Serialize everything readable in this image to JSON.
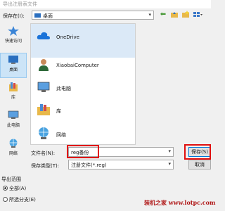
{
  "window": {
    "title": "导出注册表文件"
  },
  "toolbar": {
    "save_in_label": "保存在(I):",
    "save_in_value": "桌面",
    "back_icon": "back-arrow-icon",
    "up_icon": "up-folder-icon",
    "new_folder_icon": "new-folder-icon",
    "view_menu_icon": "view-menu-icon"
  },
  "places": [
    {
      "label": "快速访问",
      "icon": "star-icon"
    },
    {
      "label": "桌面",
      "icon": "desktop-icon",
      "selected": true
    },
    {
      "label": "库",
      "icon": "library-icon"
    },
    {
      "label": "此电脑",
      "icon": "computer-icon"
    },
    {
      "label": "网络",
      "icon": "network-icon"
    }
  ],
  "files": [
    {
      "name": "OneDrive",
      "icon": "cloud-icon"
    },
    {
      "name": "XiaobaiComputer",
      "icon": "user-icon"
    },
    {
      "name": "此电脑",
      "icon": "computer-icon"
    },
    {
      "name": "库",
      "icon": "library-icon"
    },
    {
      "name": "网络",
      "icon": "network-icon"
    }
  ],
  "form": {
    "filename_label": "文件名(N):",
    "filename_value": "reg备份",
    "type_label": "保存类型(T):",
    "type_value": "注册文件(*.reg)",
    "save_label": "保存(S)",
    "cancel_label": "取消"
  },
  "export_range": {
    "label": "导出范围",
    "options": [
      {
        "label": "全部(A)",
        "checked": true
      },
      {
        "label": "所选分支(E)",
        "checked": false
      }
    ]
  },
  "watermark": "装机之家 www.lotpc.com",
  "colors": {
    "highlight": "#cce4f7",
    "annotation_red": "#e01010",
    "accent": "#0078d7"
  }
}
